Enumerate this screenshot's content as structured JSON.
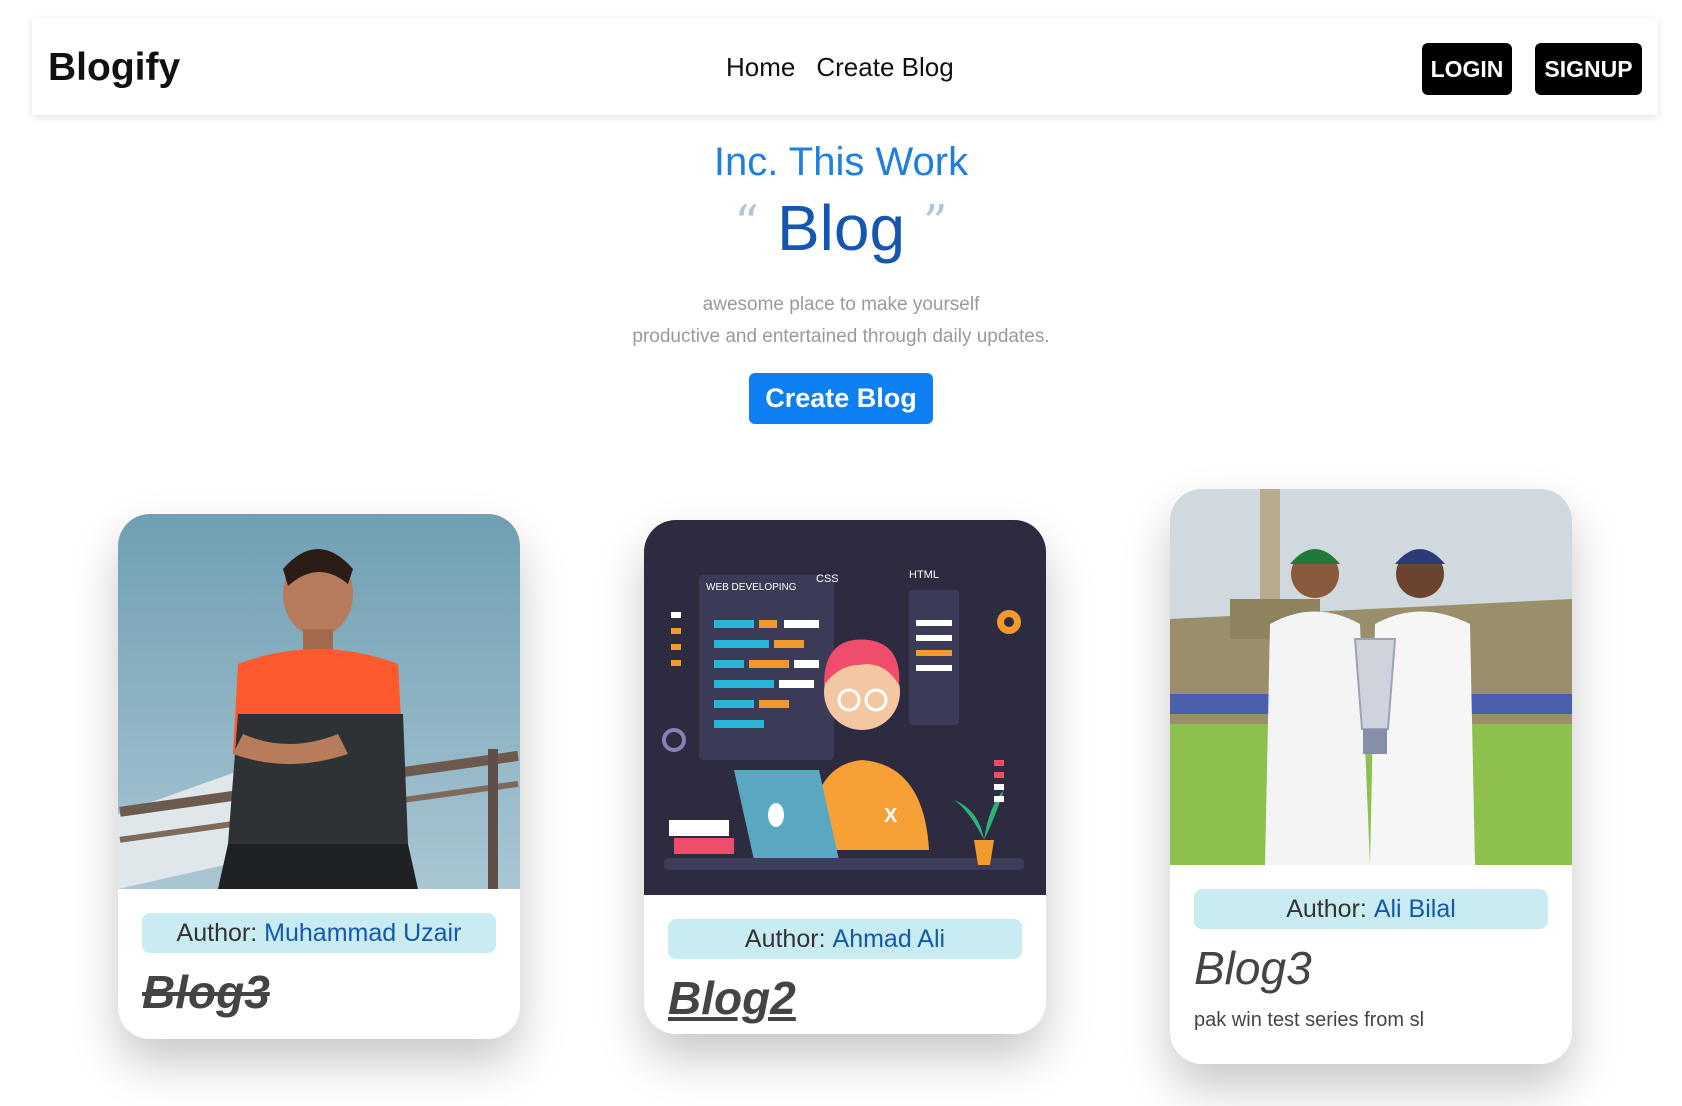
{
  "navbar": {
    "brand": "Blogify",
    "links": [
      "Home",
      "Create Blog"
    ],
    "login_label": "LOGIN",
    "signup_label": "SIGNUP"
  },
  "hero": {
    "subtitle": "Inc. This Work",
    "open_quote": "“",
    "title": "Blog",
    "close_quote": "”",
    "desc_line1": "awesome place to make yourself",
    "desc_line2": "productive and entertained through daily updates.",
    "button_label": "Create Blog"
  },
  "cards": [
    {
      "author_label": "Author:",
      "author": "Muhammad Uzair",
      "title": "Blog3",
      "desc": ""
    },
    {
      "author_label": "Author:",
      "author": "Ahmad Ali",
      "title": "Blog2",
      "desc": ""
    },
    {
      "author_label": "Author:",
      "author": "Ali Bilal",
      "title": "Blog3",
      "desc": "pak win test series from sl"
    }
  ],
  "colors": {
    "accent": "#0d7ff0",
    "author_pill": "#c9ecf3",
    "hero_title": "#1557b0"
  }
}
